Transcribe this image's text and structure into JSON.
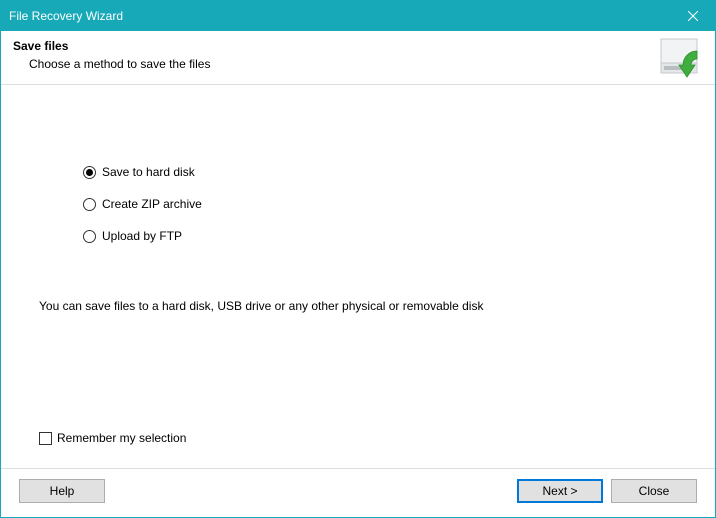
{
  "titlebar": {
    "title": "File Recovery Wizard"
  },
  "header": {
    "heading": "Save files",
    "subheading": "Choose a method to save the files"
  },
  "options": {
    "save_hdd": "Save to hard disk",
    "create_zip": "Create ZIP archive",
    "upload_ftp": "Upload by FTP"
  },
  "hint": "You can save files to a hard disk, USB drive or any other physical or removable disk",
  "remember_label": "Remember my selection",
  "buttons": {
    "help": "Help",
    "next": "Next >",
    "close": "Close"
  }
}
